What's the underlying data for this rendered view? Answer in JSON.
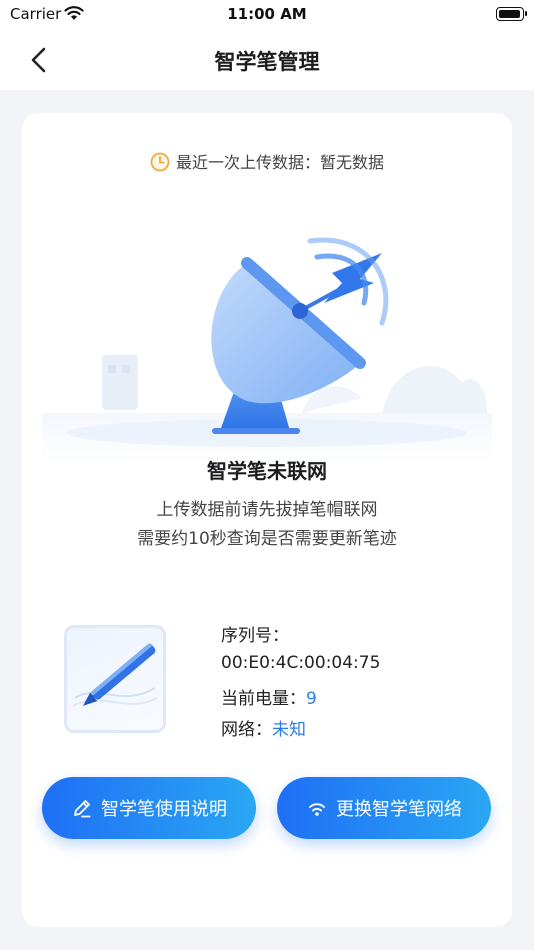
{
  "status_bar": {
    "carrier": "Carrier",
    "time": "11:00 AM"
  },
  "header": {
    "title": "智学笔管理"
  },
  "card": {
    "last_upload": "最近一次上传数据：暂无数据",
    "headline": "智学笔未联网",
    "desc_line1": "上传数据前请先拔掉笔帽联网",
    "desc_line2": "需要约10秒查询是否需要更新笔迹"
  },
  "device": {
    "serial_label": "序列号：",
    "serial_value": "00:E0:4C:00:04:75",
    "battery_label": "当前电量：",
    "battery_value": "9",
    "network_label": "网络：",
    "network_value": "未知"
  },
  "buttons": {
    "guide_label": "智学笔使用说明",
    "network_label": "更换智学笔网络"
  },
  "colors": {
    "accent": "#2b7de9",
    "button_start": "#1f6ff5",
    "button_end": "#2aa7f3",
    "clock": "#f2a93b",
    "background": "#f3f4f8"
  },
  "icons": {
    "back": "chevron-left-icon",
    "clock": "clock-icon",
    "pen": "pen-icon",
    "wifi": "wifi-icon"
  }
}
